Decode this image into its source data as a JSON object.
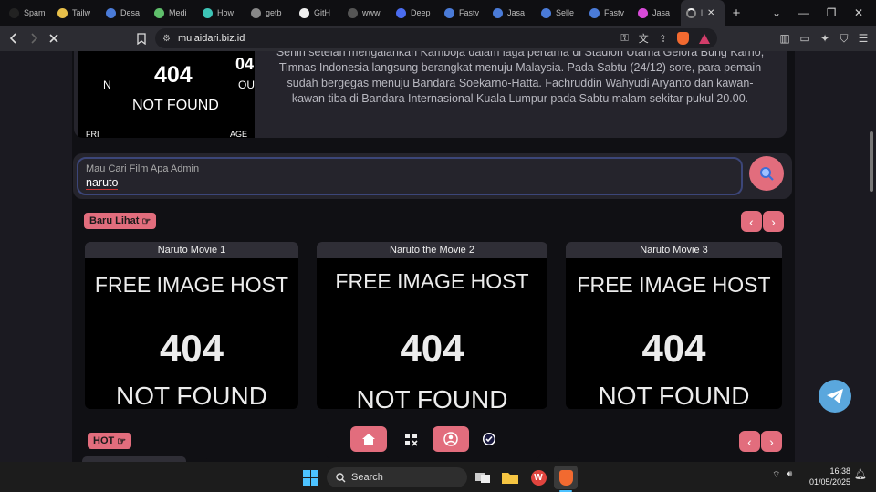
{
  "browser": {
    "tabs": [
      {
        "label": "Spam",
        "color": "#222222"
      },
      {
        "label": "Tailw",
        "color": "#e8c04a"
      },
      {
        "label": "Desa",
        "color": "#4a7bd8"
      },
      {
        "label": "Medi",
        "color": "#5fbf6b"
      },
      {
        "label": "How",
        "color": "#3dc4b6"
      },
      {
        "label": "getb",
        "color": "#888888"
      },
      {
        "label": "GitH",
        "color": "#eeeeee"
      },
      {
        "label": "www",
        "color": "#555555"
      },
      {
        "label": "Deep",
        "color": "#4a6cf0"
      },
      {
        "label": "Fastv",
        "color": "#4a7bd8"
      },
      {
        "label": "Jasa",
        "color": "#4a7bd8"
      },
      {
        "label": "Selle",
        "color": "#4a7bd8"
      },
      {
        "label": "Fastv",
        "color": "#4a7bd8"
      },
      {
        "label": "Jasa",
        "color": "#d84ad8"
      }
    ],
    "active_tab": {
      "label": "l"
    },
    "new_tab": "+",
    "url": "mulaidari.biz.id"
  },
  "news": {
    "image_text": {
      "code": "404",
      "not_found": "NOT FOUND",
      "frag_left": "N",
      "frag_right": "OUN",
      "frag_code": "04",
      "frag_b1": "FRI",
      "frag_b2": "AGE"
    },
    "paragraph": "Senin setelah mengalahkan Kamboja dalam laga pertama di Stadion Utama Gelora Bung Karno, Timnas Indonesia langsung berangkat menuju Malaysia. Pada Sabtu (24/12) sore, para pemain sudah bergegas menuju Bandara Soekarno-Hatta. Fachruddin Wahyudi Aryanto dan kawan-kawan tiba di Bandara Internasional Kuala Lumpur pada Sabtu malam sekitar pukul 20.00."
  },
  "search": {
    "label": "Mau Cari Film Apa Admin",
    "value": "naruto"
  },
  "sections": {
    "recent": {
      "label": "Baru Lihat"
    },
    "hot": {
      "label": "HOT"
    }
  },
  "movies": [
    {
      "title": "Naruto Movie 1",
      "l1": "FREE IMAGE HOST",
      "l2": "404",
      "l3": "NOT FOUND"
    },
    {
      "title": "Naruto the Movie 2",
      "l1": "FREE IMAGE HOST",
      "l2": "404",
      "l3": "NOT FOUND"
    },
    {
      "title": "Naruto Movie 3",
      "l1": "FREE IMAGE HOST",
      "l2": "404",
      "l3": "NOT FOUND"
    }
  ],
  "taskbar": {
    "search_label": "Search",
    "time": "16:38",
    "date": "01/05/2025"
  },
  "colors": {
    "accent": "#e26d7d",
    "telegram": "#5aa7dd",
    "search_border": "#3c4679"
  }
}
